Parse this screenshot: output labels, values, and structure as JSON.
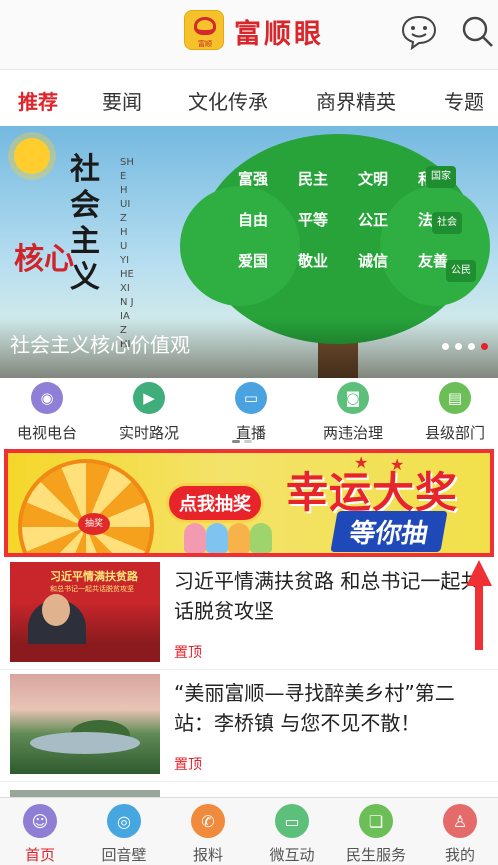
{
  "header": {
    "logo_small_text": "富顺",
    "app_title": "富顺眼"
  },
  "tabs": [
    {
      "label": "推荐"
    },
    {
      "label": "要闻"
    },
    {
      "label": "文化传承"
    },
    {
      "label": "商界精英"
    },
    {
      "label": "专题"
    }
  ],
  "banner": {
    "vertical_title": "社会主义",
    "core_text": "核心",
    "caption": "社会主义核心价值观",
    "pinyin": "SHE HUI ZHU YI HE XIN JIA ZHI",
    "value_rows": [
      [
        "富强",
        "民主",
        "文明",
        "和谐"
      ],
      [
        "自由",
        "平等",
        "公正",
        "法治"
      ],
      [
        "爱国",
        "敬业",
        "诚信",
        "友善"
      ]
    ],
    "side_tags": [
      "国家",
      "社会",
      "公民"
    ]
  },
  "quick_nav": [
    {
      "label": "电视电台",
      "color": "#8f7fd6"
    },
    {
      "label": "实时路况",
      "color": "#3fae7b"
    },
    {
      "label": "直播",
      "color": "#4aa3e0"
    },
    {
      "label": "两违治理",
      "color": "#5cc07a"
    },
    {
      "label": "县级部门",
      "color": "#6bbf56"
    }
  ],
  "ad": {
    "wheel_center": "抽奖",
    "draw_label": "点我抽奖",
    "headline": "幸运大奖",
    "subline": "等你抽"
  },
  "news": [
    {
      "title": "习近平情满扶贫路 和总书记一起共话脱贫攻坚",
      "tag": "置顶",
      "thumb_text1": "习近平情满扶贫路",
      "thumb_text2": "和总书记一起共话脱贫攻坚"
    },
    {
      "title": "“美丽富顺—寻找醉美乡村”第二站：李桥镇 与您不见不散！",
      "tag": "置顶"
    }
  ],
  "bottom_nav": [
    {
      "label": "首页",
      "color": "#8e7fd4",
      "active": true
    },
    {
      "label": "回音壁",
      "color": "#45a6e0"
    },
    {
      "label": "报料",
      "color": "#f08a3c"
    },
    {
      "label": "微互动",
      "color": "#5cc07a"
    },
    {
      "label": "民生服务",
      "color": "#6bbf56"
    },
    {
      "label": "我的",
      "color": "#e56b6b"
    }
  ],
  "colors": {
    "brand_red": "#e0242b",
    "ad_border": "#ef3034",
    "ad_yellow": "#f8df2f"
  }
}
